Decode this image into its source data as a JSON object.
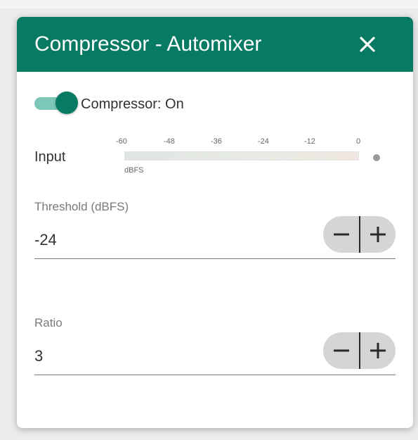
{
  "dialog": {
    "title": "Compressor - Automixer",
    "close_icon": "close-icon"
  },
  "compressor": {
    "label": "Compressor: On",
    "enabled": true
  },
  "input_meter": {
    "label": "Input",
    "scale_ticks": [
      "-60",
      "-48",
      "-36",
      "-24",
      "-12",
      "0"
    ],
    "unit": "dBFS"
  },
  "threshold": {
    "label": "Threshold (dBFS)",
    "value": "-24",
    "decrement_icon": "minus-icon",
    "increment_icon": "plus-icon"
  },
  "ratio": {
    "label": "Ratio",
    "value": "3",
    "decrement_icon": "minus-icon",
    "increment_icon": "plus-icon"
  },
  "colors": {
    "header": "#067a63",
    "toggle_knob": "#067a63",
    "toggle_track": "#7cc7b7",
    "stepper_bg": "#d5d5d5"
  }
}
